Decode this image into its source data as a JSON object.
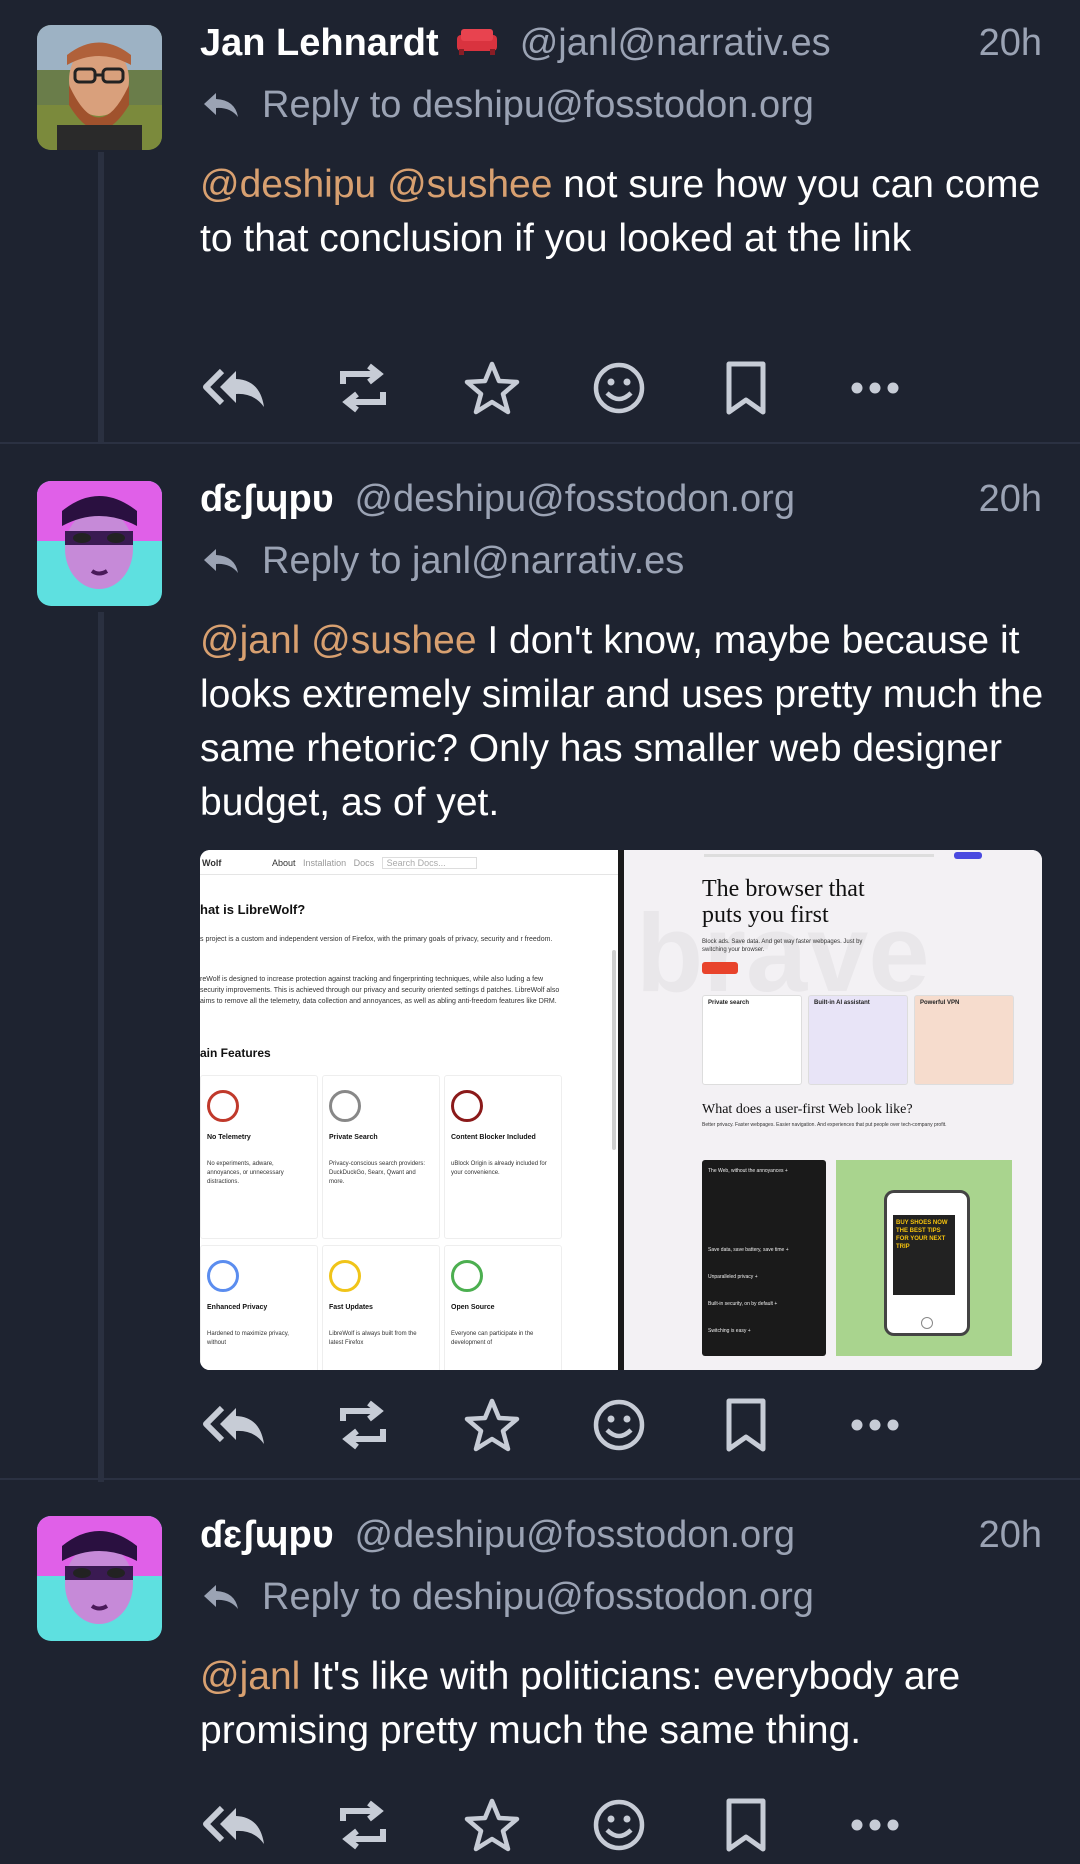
{
  "posts": [
    {
      "display_name": "Jan Lehnardt",
      "badge": "sofa-emoji",
      "handle": "@janl@narrativ.es",
      "time": "20h",
      "reply_to": "Reply to deshipu@fosstodon.org",
      "mentions": [
        "@deshipu",
        "@sushee"
      ],
      "text": "not sure how you can come to that conclusion if you looked at the link"
    },
    {
      "display_name": "ɗɛʃɰpʋ",
      "handle": "@deshipu@fosstodon.org",
      "time": "20h",
      "reply_to": "Reply to janl@narrativ.es",
      "mentions": [
        "@janl",
        "@sushee"
      ],
      "text": "I don't know, maybe because it looks extremely similar and uses pretty much the same rhetoric? Only has smaller web designer budget, as of yet.",
      "attachment": {
        "left": {
          "nav": [
            "About",
            "Installation",
            "Docs",
            "Search Docs..."
          ],
          "heading": "hat is LibreWolf?",
          "paragraph1": "s project is a custom and independent version of Firefox, with the primary goals of privacy, security and r freedom.",
          "paragraph2": "reWolf is designed to increase protection against tracking and fingerprinting techniques, while also luding a few security improvements. This is achieved through our privacy and security oriented settings d patches. LibreWolf also aims to remove all the telemetry, data collection and annoyances, as well as abling anti-freedom features like DRM.",
          "features_heading": "ain Features",
          "features": [
            {
              "title": "No Telemetry",
              "desc": "No experiments, adware, annoyances, or unnecessary distractions."
            },
            {
              "title": "Private Search",
              "desc": "Privacy-conscious search providers: DuckDuckGo, Searx, Qwant and more."
            },
            {
              "title": "Content Blocker Included",
              "desc": "uBlock Origin is already included for your convenience."
            },
            {
              "title": "Enhanced Privacy",
              "desc": "Hardened to maximize privacy, without"
            },
            {
              "title": "Fast Updates",
              "desc": "LibreWolf is always built from the latest Firefox"
            },
            {
              "title": "Open Source",
              "desc": "Everyone can participate in the development of"
            }
          ]
        },
        "right": {
          "watermark": "brave",
          "hero_title": "The browser that puts you first",
          "hero_sub": "Block ads. Save data. And get way faster webpages. Just by switching your browser.",
          "cards": [
            "Private search",
            "Built-in AI assistant",
            "Powerful VPN"
          ],
          "section_title": "What does a user-first Web look like?",
          "section_sub": "Better privacy. Faster webpages. Easier navigation. And experiences that put people over tech-company profit.",
          "accordion": [
            "The Web, without the annoyances",
            "Save data, save battery, save time",
            "Unparalleled privacy",
            "Built-in security, on by default",
            "Switching is easy"
          ],
          "phone_text": "BUY SHOES NOW THE BEST TIPS FOR YOUR NEXT TRIP"
        }
      }
    },
    {
      "display_name": "ɗɛʃɰpʋ",
      "handle": "@deshipu@fosstodon.org",
      "time": "20h",
      "reply_to": "Reply to deshipu@fosstodon.org",
      "mentions": [
        "@janl"
      ],
      "text": "It's like with politicians: everybody are promising pretty much the same thing."
    }
  ],
  "action_icons": [
    "reply-all-icon",
    "boost-icon",
    "favourite-icon",
    "emoji-react-icon",
    "bookmark-icon",
    "more-icon"
  ],
  "colors": {
    "background": "#1e2330",
    "mention": "#d8a070",
    "muted": "#9ba3b4",
    "icon": "#c7ccd6"
  }
}
